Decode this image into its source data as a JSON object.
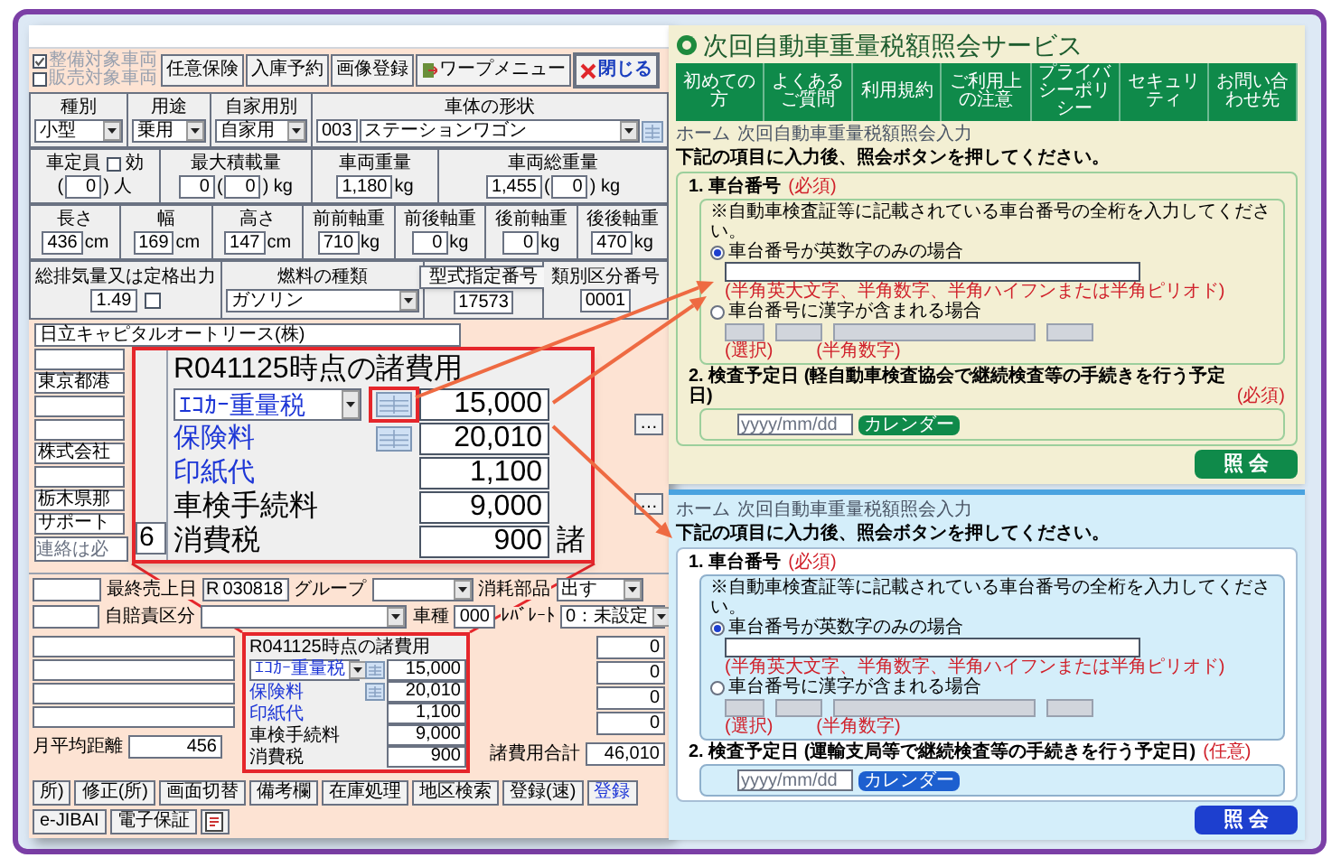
{
  "app": {
    "toolbar": {
      "checks": [
        {
          "label": "整備対象車両",
          "checked": true
        },
        {
          "label": "販売対象車両",
          "checked": false
        }
      ],
      "buttons": [
        {
          "kind": "plain",
          "label": "任意保険"
        },
        {
          "kind": "plain",
          "label": "入庫予約"
        },
        {
          "kind": "plain",
          "label": "画像登録"
        },
        {
          "kind": "menu",
          "label": "ワープメニュー"
        },
        {
          "kind": "close",
          "label": "閉じる"
        }
      ]
    },
    "spec_rows": [
      [
        {
          "kind": "plain",
          "label": "種別",
          "items": [
            {
              "kind": "select",
              "value": "小型"
            }
          ]
        },
        {
          "kind": "plain",
          "label": "用途",
          "items": [
            {
              "kind": "select",
              "value": "乗用"
            }
          ]
        },
        {
          "kind": "plain",
          "label": "自家用別",
          "items": [
            {
              "kind": "select",
              "value": "自家用"
            }
          ]
        },
        {
          "kind": "plain",
          "label": "車体の形状",
          "items": [
            {
              "kind": "input",
              "value": "003"
            },
            {
              "kind": "select",
              "value": "ステーションワゴン"
            },
            {
              "kind": "icon"
            }
          ]
        }
      ],
      [
        {
          "kind": "plain",
          "label": "車定員",
          "check": {
            "label": "効",
            "checked": false
          },
          "items": [
            {
              "kind": "text",
              "text": "("
            },
            {
              "kind": "input",
              "value": "0"
            },
            {
              "kind": "text",
              "text": ") 人"
            }
          ]
        },
        {
          "kind": "plain",
          "label": "最大積載量",
          "items": [
            {
              "kind": "input",
              "value": "0"
            },
            {
              "kind": "text",
              "text": "("
            },
            {
              "kind": "input",
              "value": "0"
            },
            {
              "kind": "text",
              "text": ") kg"
            }
          ]
        },
        {
          "kind": "plain",
          "label": "車両重量",
          "items": [
            {
              "kind": "input",
              "value": "1,180"
            },
            {
              "kind": "text",
              "text": "kg"
            }
          ]
        },
        {
          "kind": "plain",
          "label": "車両総重量",
          "items": [
            {
              "kind": "input",
              "value": "1,455"
            },
            {
              "kind": "text",
              "text": "("
            },
            {
              "kind": "input",
              "value": "0"
            },
            {
              "kind": "text",
              "text": ") kg"
            }
          ]
        }
      ],
      [
        {
          "kind": "plain",
          "label": "長さ",
          "items": [
            {
              "kind": "input",
              "value": "436"
            },
            {
              "kind": "text",
              "text": "cm"
            }
          ]
        },
        {
          "kind": "plain",
          "label": "幅",
          "items": [
            {
              "kind": "input",
              "value": "169"
            },
            {
              "kind": "text",
              "text": "cm"
            }
          ]
        },
        {
          "kind": "plain",
          "label": "高さ",
          "items": [
            {
              "kind": "input",
              "value": "147"
            },
            {
              "kind": "text",
              "text": "cm"
            }
          ]
        },
        {
          "kind": "plain",
          "label": "前前軸重",
          "items": [
            {
              "kind": "input",
              "value": "710"
            },
            {
              "kind": "text",
              "text": "kg"
            }
          ]
        },
        {
          "kind": "plain",
          "label": "前後軸重",
          "items": [
            {
              "kind": "input",
              "value": "0"
            },
            {
              "kind": "text",
              "text": "kg"
            }
          ]
        },
        {
          "kind": "plain",
          "label": "後前軸重",
          "items": [
            {
              "kind": "input",
              "value": "0"
            },
            {
              "kind": "text",
              "text": "kg"
            }
          ]
        },
        {
          "kind": "plain",
          "label": "後後軸重",
          "items": [
            {
              "kind": "input",
              "value": "470"
            },
            {
              "kind": "text",
              "text": "kg"
            }
          ]
        }
      ],
      [
        {
          "kind": "plain",
          "label": "総排気量又は定格出力",
          "items": [
            {
              "kind": "input",
              "value": "1.49"
            },
            {
              "kind": "check",
              "checked": false
            }
          ]
        },
        {
          "kind": "plain",
          "label": "燃料の種類",
          "items": [
            {
              "kind": "select",
              "value": "ガソリン"
            }
          ]
        },
        {
          "kind": "button",
          "label": "型式指定番号",
          "items": [
            {
              "kind": "input",
              "value": "17573"
            }
          ]
        },
        {
          "kind": "plain",
          "label": "類別区分番号",
          "items": [
            {
              "kind": "input",
              "value": "0001"
            }
          ]
        }
      ]
    ],
    "owner": {
      "lead": "日立キャピタルオートリース(株)",
      "rows": [
        {
          "kind": "blank"
        },
        {
          "kind": "field",
          "value": "東京都港"
        },
        {
          "kind": "blank"
        },
        {
          "kind": "blank"
        },
        {
          "kind": "field",
          "value": "株式会社"
        },
        {
          "kind": "blank"
        },
        {
          "kind": "field",
          "value": "栃木県那"
        },
        {
          "kind": "field",
          "value": "サポート"
        },
        {
          "kind": "hint",
          "placeholder": "連絡は必"
        }
      ],
      "side_buttons": [
        "…",
        "…"
      ]
    },
    "callout": {
      "title": "R041125時点の諸費用",
      "side_value": "6",
      "tail_label": "諸",
      "items": [
        {
          "kind": "select",
          "label": "ｴｺｶｰ重量税",
          "value": "15,000",
          "calc": true,
          "highlighted": true
        },
        {
          "kind": "link",
          "label": "保険料",
          "value": "20,010",
          "calc": true,
          "highlighted": false
        },
        {
          "kind": "link",
          "label": "印紙代",
          "value": "1,100",
          "calc": false,
          "highlighted": false
        },
        {
          "kind": "plain",
          "label": "車検手続料",
          "value": "9,000",
          "calc": false,
          "highlighted": false
        },
        {
          "kind": "plain",
          "label": "消費税",
          "value": "900",
          "calc": false,
          "highlighted": false
        }
      ]
    },
    "bottom": {
      "sale_date": {
        "label": "最終売上日",
        "prefix": "R",
        "value": "030818"
      },
      "group": {
        "label": "グループ"
      },
      "parts": {
        "label": "消耗部品",
        "value": "出す"
      },
      "liability": {
        "label": "自賠責区分"
      },
      "car_type": {
        "label": "車種",
        "value": "000"
      },
      "rate": {
        "label": "ﾚﾊﾞﾚｰﾄ",
        "value": "0：未設定"
      },
      "fees": {
        "title": "R041125時点の諸費用",
        "highlighted": true,
        "items": [
          {
            "kind": "select",
            "label": "ｴｺｶｰ重量税",
            "value": "15,000",
            "calc": true
          },
          {
            "kind": "link",
            "label": "保険料",
            "value": "20,010",
            "calc": true
          },
          {
            "kind": "link",
            "label": "印紙代",
            "value": "1,100",
            "calc": false
          },
          {
            "kind": "plain",
            "label": "車検手続料",
            "value": "9,000",
            "calc": false
          },
          {
            "kind": "plain",
            "label": "消費税",
            "value": "900",
            "calc": false
          }
        ]
      },
      "right_values": [
        "0",
        "0",
        "0",
        "0"
      ],
      "total": {
        "label": "諸費用合計",
        "value": "46,010"
      },
      "mileage": {
        "label": "月平均距離",
        "value": "456"
      },
      "buttons": [
        {
          "kind": "plain",
          "label": "所)"
        },
        {
          "kind": "plain",
          "label": "修正(所)"
        },
        {
          "kind": "plain",
          "label": "画面切替"
        },
        {
          "kind": "plain",
          "label": "備考欄"
        },
        {
          "kind": "plain",
          "label": "在庫処理"
        },
        {
          "kind": "plain",
          "label": "地区検索"
        },
        {
          "kind": "plain",
          "label": "登録(速)"
        },
        {
          "kind": "accent",
          "label": "登録"
        },
        {
          "kind": "plain",
          "label": "e-JIBAI"
        },
        {
          "kind": "plain",
          "label": "電子保証"
        },
        {
          "kind": "icon"
        }
      ]
    }
  },
  "pages": [
    {
      "kind": "green",
      "header": {
        "title": "次回自動車重量税額照会サービス",
        "nav": [
          "初めての方",
          "よくあるご質問",
          "利用規約",
          "ご利用上の注意",
          "プライバシーポリシー",
          "セキュリティ",
          "お問い合わせ先"
        ]
      },
      "breadcrumb": [
        "ホーム",
        "次回自動車重量税額照会入力"
      ],
      "instruction": "下記の項目に入力後、照会ボタンを押してください。",
      "section1": {
        "heading": "1. 車台番号",
        "tag": "(必須)",
        "note": "※自動車検査証等に記載されている車台番号の全桁を入力してください。",
        "options": [
          {
            "label": "車台番号が英数字のみの場合",
            "selected": true
          },
          {
            "label": "車台番号に漢字が含まれる場合",
            "selected": false
          }
        ],
        "hint": "(半角英大文字、半角数字、半角ハイフンまたは半角ピリオド)",
        "hint_select": "(選択)",
        "hint_digits": "(半角数字)"
      },
      "section2": {
        "heading": "2. 検査予定日 (軽自動車検査協会で継続検査等の手続きを行う予定日)",
        "tag": "(必須)",
        "placeholder": "yyyy/mm/dd",
        "button": "カレンダー"
      },
      "submit": "照 会"
    },
    {
      "kind": "blue",
      "breadcrumb": [
        "ホーム",
        "次回自動車重量税額照会入力"
      ],
      "instruction": "下記の項目に入力後、照会ボタンを押してください。",
      "section1": {
        "heading": "1. 車台番号",
        "tag": "(必須)",
        "note": "※自動車検査証等に記載されている車台番号の全桁を入力してください。",
        "options": [
          {
            "label": "車台番号が英数字のみの場合",
            "selected": true
          },
          {
            "label": "車台番号に漢字が含まれる場合",
            "selected": false
          }
        ],
        "hint": "(半角英大文字、半角数字、半角ハイフンまたは半角ピリオド)",
        "hint_select": "(選択)",
        "hint_digits": "(半角数字)"
      },
      "section2": {
        "heading": "2. 検査予定日 (運輸支局等で継続検査等の手続きを行う予定日)",
        "tag": "(任意)",
        "placeholder": "yyyy/mm/dd",
        "button": "カレンダー"
      },
      "submit": "照 会"
    }
  ]
}
